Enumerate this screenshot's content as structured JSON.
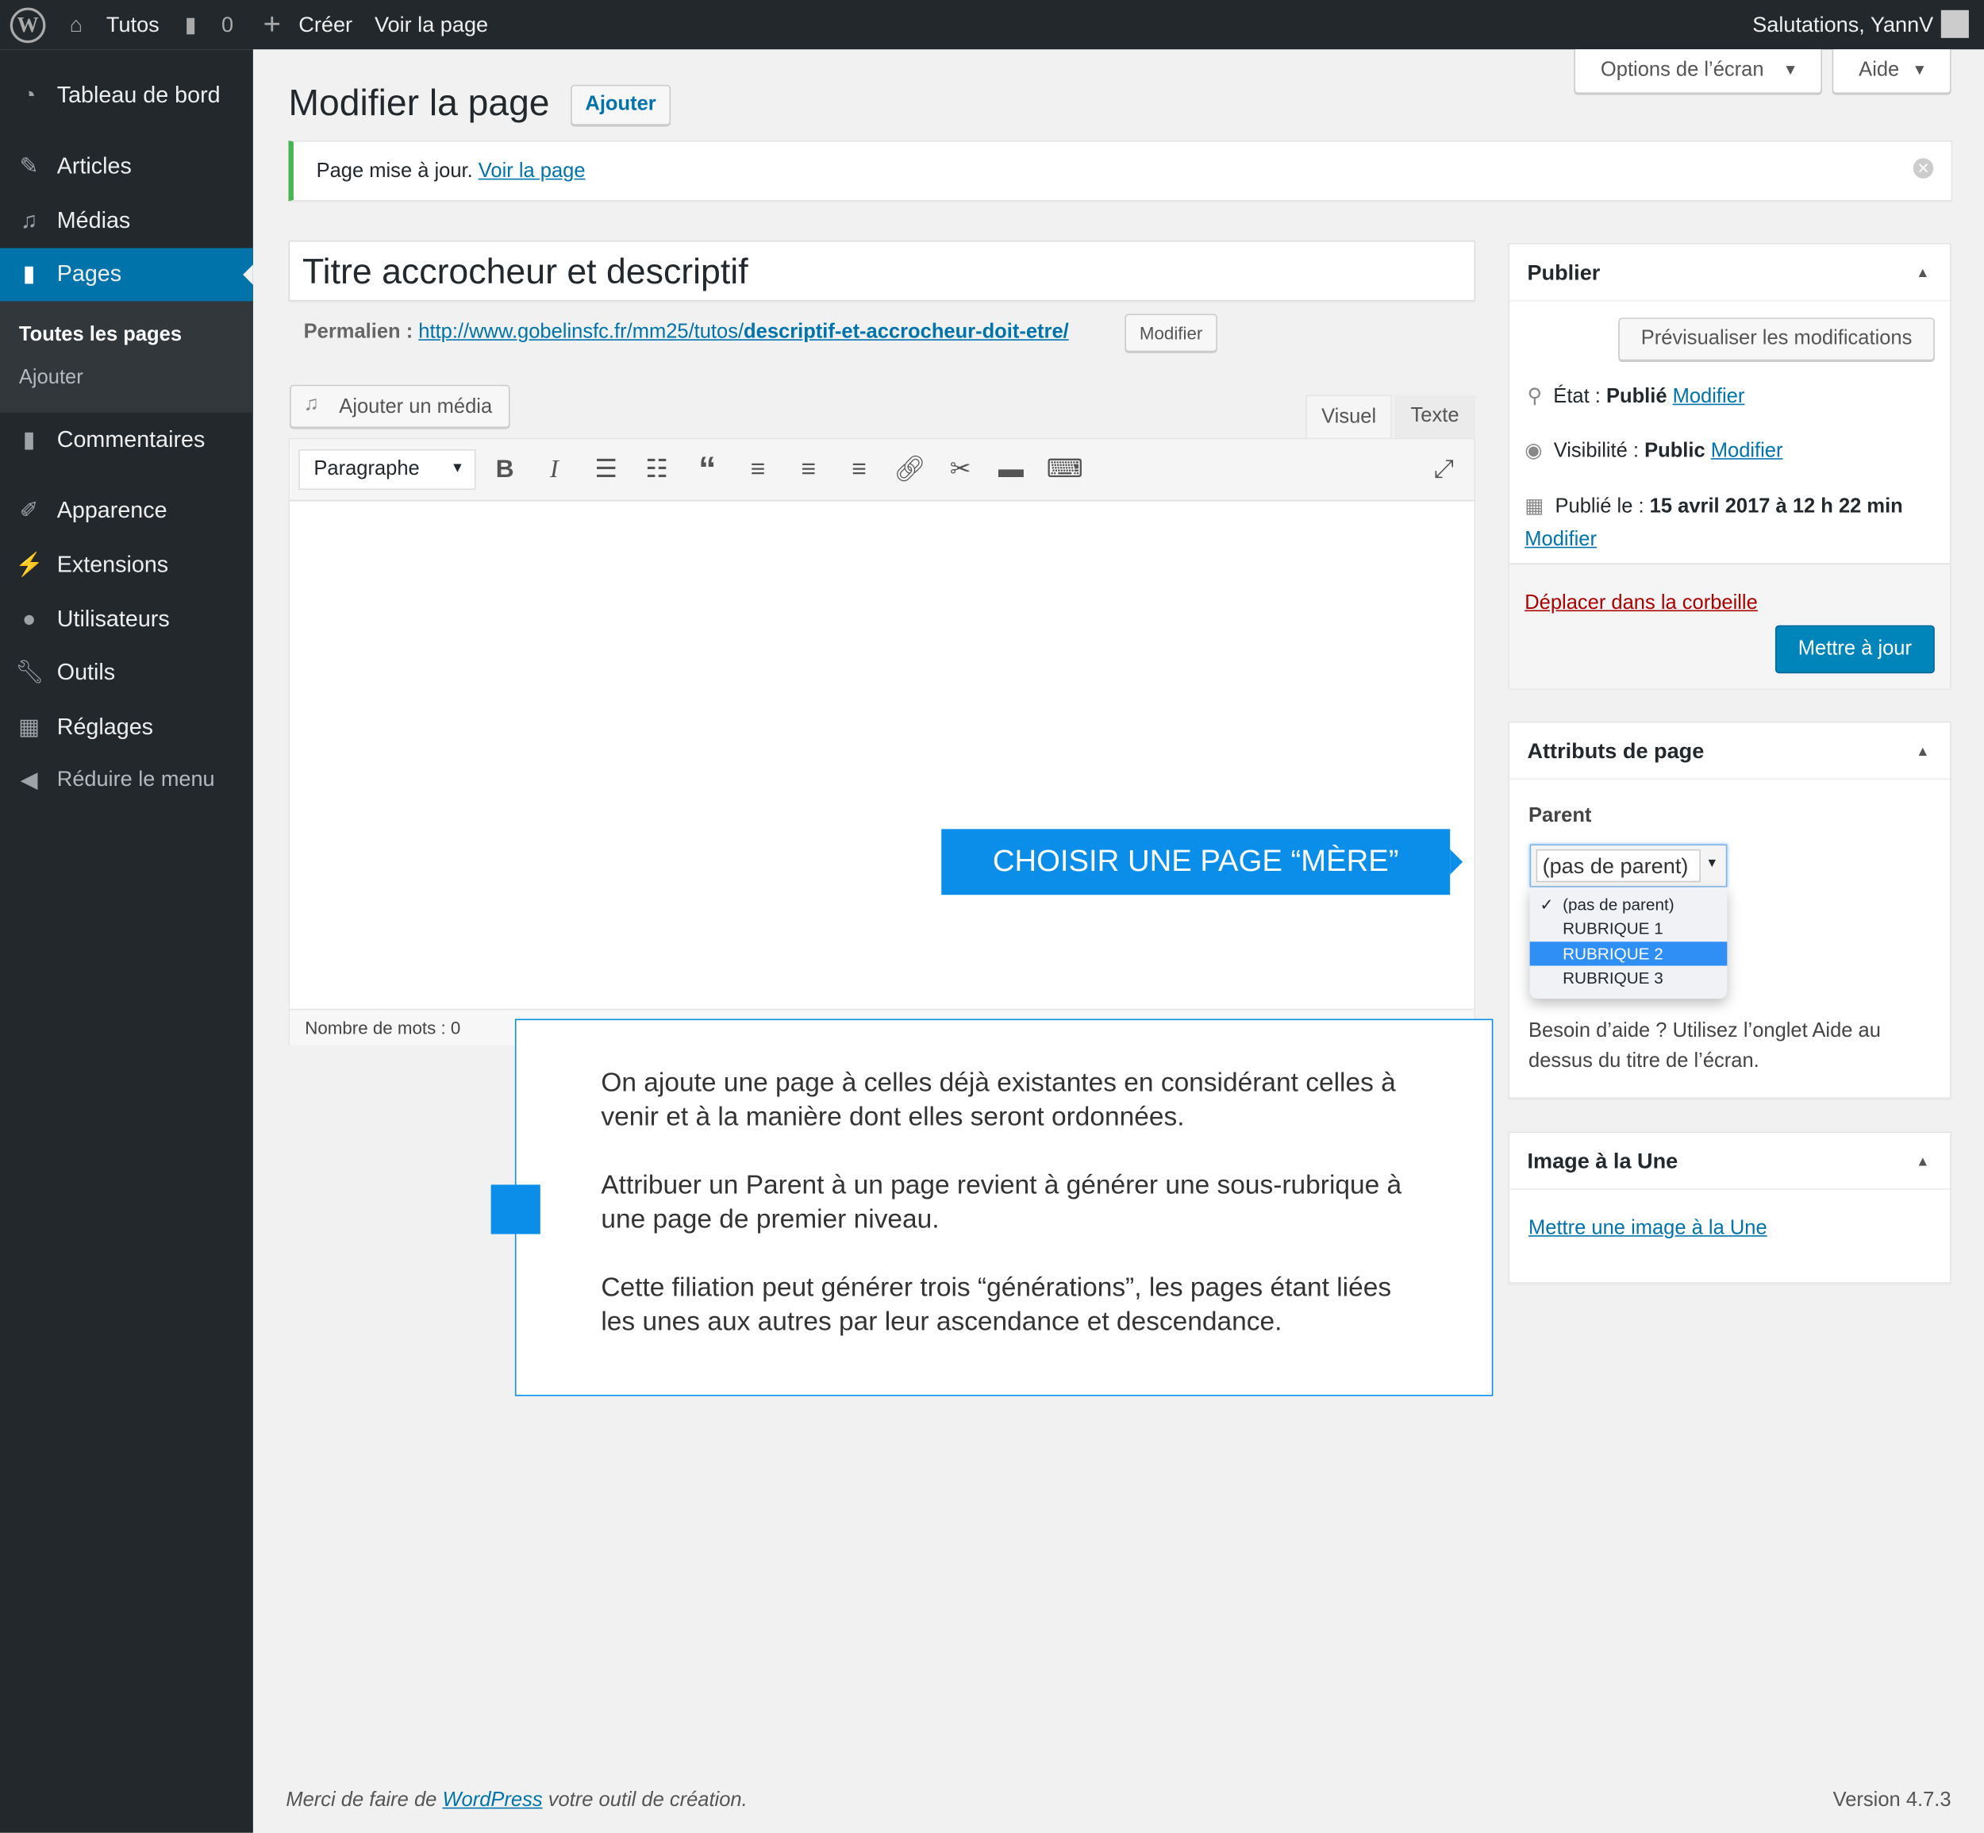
{
  "adminbar": {
    "site": "Tutos",
    "comments": "0",
    "create": "Créer",
    "view": "Voir la page",
    "greeting": "Salutations, YannV"
  },
  "sidebar": {
    "items": [
      {
        "label": "Tableau de bord",
        "icon": "dashboard-icon"
      },
      {
        "label": "Articles",
        "icon": "pin-icon"
      },
      {
        "label": "Médias",
        "icon": "media-icon"
      },
      {
        "label": "Pages",
        "icon": "pages-icon"
      },
      {
        "label": "Commentaires",
        "icon": "comment-icon"
      },
      {
        "label": "Apparence",
        "icon": "brush-icon"
      },
      {
        "label": "Extensions",
        "icon": "plugin-icon"
      },
      {
        "label": "Utilisateurs",
        "icon": "user-icon"
      },
      {
        "label": "Outils",
        "icon": "wrench-icon"
      },
      {
        "label": "Réglages",
        "icon": "settings-icon"
      },
      {
        "label": "Réduire le menu",
        "icon": "collapse-icon"
      }
    ],
    "submenu": [
      "Toutes les pages",
      "Ajouter"
    ]
  },
  "header": {
    "screen_options": "Options de l’écran",
    "help": "Aide",
    "title": "Modifier la page",
    "add": "Ajouter"
  },
  "notice": {
    "text": "Page mise à jour.",
    "link": "Voir la page"
  },
  "editor": {
    "title": "Titre accrocheur et descriptif",
    "permalink_label": "Permalien :",
    "permalink_base": "http://www.gobelinsfc.fr/mm25/tutos/",
    "permalink_slug": "descriptif-et-accrocheur-doit-etre/",
    "permalink_edit": "Modifier",
    "add_media": "Ajouter un média",
    "tab_visual": "Visuel",
    "tab_text": "Texte",
    "format": "Paragraphe",
    "word_count": "Nombre de mots : 0"
  },
  "publish": {
    "title": "Publier",
    "preview": "Prévisualiser les modifications",
    "state_label": "État :",
    "state": "Publié",
    "visibility_label": "Visibilité :",
    "visibility": "Public",
    "published_label": "Publié le :",
    "published": "15 avril 2017 à 12 h 22 min",
    "edit": "Modifier",
    "trash": "Déplacer dans la corbeille",
    "update": "Mettre à jour"
  },
  "attributes": {
    "title": "Attributs de page",
    "parent_label": "Parent",
    "selected": "(pas de parent)",
    "options": [
      "(pas de parent)",
      "RUBRIQUE 1",
      "RUBRIQUE 2",
      "RUBRIQUE 3"
    ],
    "highlighted": "RUBRIQUE 2",
    "help": "Besoin d’aide ? Utilisez l’onglet Aide au dessus du titre de l’écran."
  },
  "featured": {
    "title": "Image à la Une",
    "link": "Mettre une image à la Une"
  },
  "callout": {
    "label": "CHOISIR UNE PAGE “MÈRE”",
    "color": "#0b8ee9"
  },
  "info": {
    "paragraphs": [
      "On ajoute une page à celles déjà existantes en considérant celles à venir et à la manière dont elles seront ordonnées.",
      "Attribuer un Parent à un page revient à générer une sous-rubrique à une page de premier niveau.",
      "Cette filiation peut générer trois “générations”, les pages étant liées les unes aux autres par leur ascendance et descendance."
    ]
  },
  "footer": {
    "prefix": "Merci de faire de",
    "link": "WordPress",
    "suffix": "votre outil de création.",
    "version": "Version 4.7.3"
  }
}
